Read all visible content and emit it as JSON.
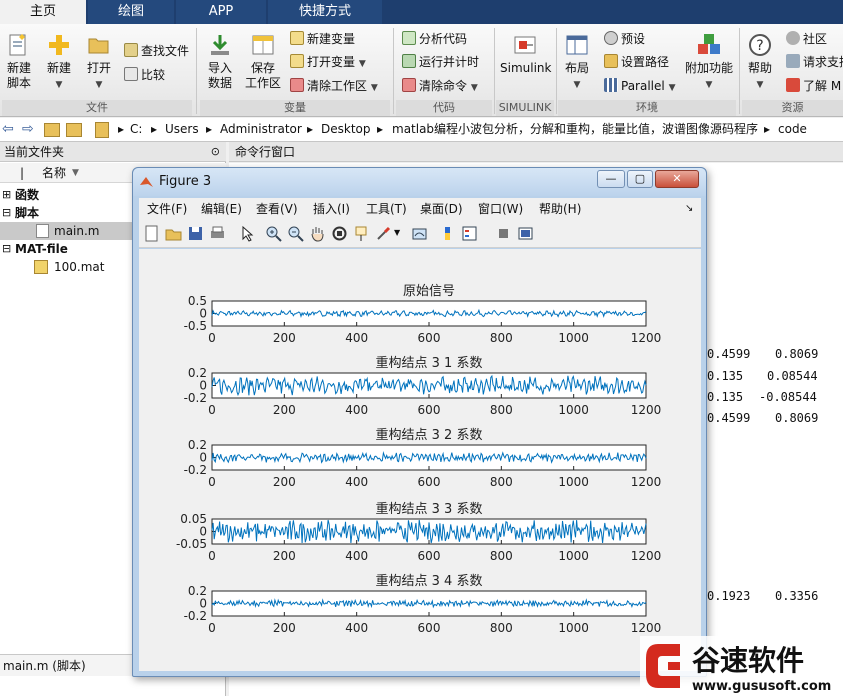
{
  "ribbon_tabs": [
    "主页",
    "绘图",
    "APP",
    "快捷方式"
  ],
  "ribbon": {
    "new_script": "新建\n脚本",
    "new": "新建",
    "open": "打开",
    "find_files": "查找文件",
    "compare": "比较",
    "import_data": "导入\n数据",
    "save_workspace": "保存\n工作区",
    "new_variable": "新建变量",
    "open_variable": "打开变量",
    "clear_workspace": "清除工作区",
    "analyze_code": "分析代码",
    "run_and_time": "运行并计时",
    "clear_commands": "清除命令",
    "simulink": "Simulink",
    "layout": "布局",
    "preferences": "预设",
    "set_path": "设置路径",
    "parallel": "Parallel",
    "addons": "附加功能",
    "help": "帮助",
    "community": "社区",
    "request_support": "请求支持",
    "learn_matlab": "了解 M",
    "groups": [
      "文件",
      "变量",
      "代码",
      "SIMULINK",
      "环境",
      "资源"
    ]
  },
  "address": {
    "path": [
      "C:",
      "Users",
      "Administrator",
      "Desktop",
      "matlab编程小波包分析，分解和重构，能量比值，波谱图像源码程序",
      "code"
    ]
  },
  "left_panel": {
    "title": "当前文件夹",
    "column": "名称",
    "sections": [
      "函数",
      "脚本",
      "MAT-file"
    ],
    "files": [
      "main.m",
      "100.mat"
    ],
    "status": "main.m  (脚本)"
  },
  "command_window": {
    "title": "命令行窗口",
    "matrix_rows": [
      [
        "0.4599",
        "0.8069"
      ],
      [
        "0.135",
        "0.08544"
      ],
      [
        "0.135",
        "-0.08544"
      ],
      [
        "0.4599",
        "0.8069"
      ]
    ],
    "row2": [
      "0.1923",
      "0.3356"
    ]
  },
  "figure": {
    "title": "Figure 3",
    "menu": [
      "文件(F)",
      "编辑(E)",
      "查看(V)",
      "插入(I)",
      "工具(T)",
      "桌面(D)",
      "窗口(W)",
      "帮助(H)"
    ],
    "win_buttons": [
      "—",
      "▢",
      "✕"
    ]
  },
  "chart_data": {
    "type": "line",
    "x_range": [
      0,
      1200
    ],
    "xticks": [
      0,
      200,
      400,
      600,
      800,
      1000,
      1200
    ],
    "series_color": "#0072bd",
    "subplots": [
      {
        "title": "原始信号",
        "yticks": [
          "0.5",
          "0",
          "-0.5"
        ],
        "ylim": [
          -0.5,
          0.5
        ],
        "amplitude": 0.08
      },
      {
        "title": "重构结点 3  1 系数",
        "yticks": [
          "0.2",
          "0",
          "-0.2"
        ],
        "ylim": [
          -0.2,
          0.2
        ],
        "amplitude": 0.1
      },
      {
        "title": "重构结点 3  2 系数",
        "yticks": [
          "0.2",
          "0",
          "-0.2"
        ],
        "ylim": [
          -0.2,
          0.2
        ],
        "amplitude": 0.05
      },
      {
        "title": "重构结点 3  3 系数",
        "yticks": [
          "0.05",
          "0",
          "-0.05"
        ],
        "ylim": [
          -0.05,
          0.05
        ],
        "amplitude": 0.03
      },
      {
        "title": "重构结点 3  4 系数",
        "yticks": [
          "0.2",
          "0",
          "-0.2"
        ],
        "ylim": [
          -0.2,
          0.2
        ],
        "amplitude": 0.035
      }
    ]
  },
  "watermark": {
    "brand": "谷速软件",
    "url": "www.gususoft.com"
  }
}
